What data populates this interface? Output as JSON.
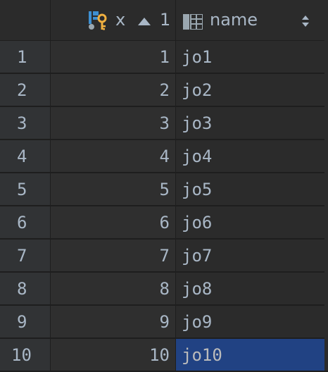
{
  "columns": {
    "x": {
      "label": "x",
      "sort_rank": "1",
      "sort_direction": "ascending",
      "icon": "primary-key-icon"
    },
    "name": {
      "label": "name",
      "icon": "table-column-icon",
      "sort_toggle_icon": "sort-toggle-icon"
    }
  },
  "rows": [
    {
      "num": "1",
      "x": "1",
      "name": "jo1"
    },
    {
      "num": "2",
      "x": "2",
      "name": "jo2"
    },
    {
      "num": "3",
      "x": "3",
      "name": "jo3"
    },
    {
      "num": "4",
      "x": "4",
      "name": "jo4"
    },
    {
      "num": "5",
      "x": "5",
      "name": "jo5"
    },
    {
      "num": "6",
      "x": "6",
      "name": "jo6"
    },
    {
      "num": "7",
      "x": "7",
      "name": "jo7"
    },
    {
      "num": "8",
      "x": "8",
      "name": "jo8"
    },
    {
      "num": "9",
      "x": "9",
      "name": "jo9"
    },
    {
      "num": "10",
      "x": "10",
      "name": "jo10"
    }
  ],
  "selected_cell": {
    "row": "10",
    "column": "name"
  },
  "colors": {
    "background": "#2b2b2b",
    "row_number_bg": "#313335",
    "text": "#a9b7c6",
    "selection": "#214283",
    "key_icon_blue": "#3d8fd1",
    "key_icon_gold": "#f0b040"
  }
}
